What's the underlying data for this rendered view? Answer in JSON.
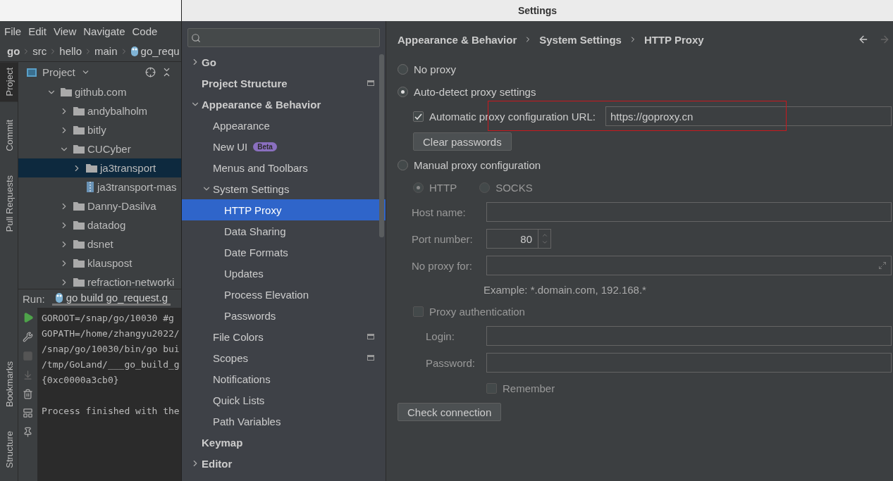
{
  "ide": {
    "menu": [
      "File",
      "Edit",
      "View",
      "Navigate",
      "Code"
    ],
    "breadcrumb": [
      {
        "label": "go",
        "kind": "root"
      },
      {
        "label": "src",
        "kind": "folder"
      },
      {
        "label": "hello",
        "kind": "folder"
      },
      {
        "label": "main",
        "kind": "folder"
      },
      {
        "label": "go_requ",
        "kind": "file"
      }
    ],
    "tool_tabs_top": [
      {
        "label": "Project",
        "selected": true
      },
      {
        "label": "Commit",
        "selected": false
      },
      {
        "label": "Pull Requests",
        "selected": false
      }
    ],
    "tool_tabs_bottom": [
      {
        "label": "Bookmarks",
        "selected": false
      },
      {
        "label": "Structure",
        "selected": false
      }
    ],
    "project_panel": {
      "title": "Project",
      "tree": [
        {
          "label": "github.com",
          "kind": "folder",
          "expanded": true,
          "selected": false,
          "children": [
            {
              "label": "andybalholm",
              "kind": "folder",
              "expanded": false,
              "selected": false
            },
            {
              "label": "bitly",
              "kind": "folder",
              "expanded": false,
              "selected": false
            },
            {
              "label": "CUCyber",
              "kind": "folder",
              "expanded": true,
              "selected": false,
              "children": [
                {
                  "label": "ja3transport",
                  "kind": "folder",
                  "expanded": false,
                  "selected": true
                },
                {
                  "label": "ja3transport-mas",
                  "kind": "archive",
                  "selected": false
                }
              ]
            },
            {
              "label": "Danny-Dasilva",
              "kind": "folder",
              "expanded": false,
              "selected": false
            },
            {
              "label": "datadog",
              "kind": "folder",
              "expanded": false,
              "selected": false
            },
            {
              "label": "dsnet",
              "kind": "folder",
              "expanded": false,
              "selected": false
            },
            {
              "label": "klauspost",
              "kind": "folder",
              "expanded": false,
              "selected": false
            },
            {
              "label": "refraction-networki",
              "kind": "folder",
              "expanded": false,
              "selected": false
            }
          ]
        }
      ]
    },
    "run": {
      "label": "Run:",
      "tab": "go build go_request.g",
      "console": [
        {
          "text": "GOROOT=/snap/go/10030 #g",
          "kind": "line"
        },
        {
          "text": "GOPATH=/home/zhangyu2022/",
          "kind": "line"
        },
        {
          "text": "/snap/go/10030/bin/go bui",
          "kind": "line"
        },
        {
          "text": "/tmp/GoLand/___go_build_g",
          "kind": "line"
        },
        {
          "text": "{0xc0000a3cb0}",
          "kind": "line"
        },
        {
          "text": "Process finished with the",
          "kind": "exit"
        }
      ]
    }
  },
  "settings": {
    "title": "Settings",
    "sidebar": [
      {
        "label": "Go",
        "expanded": false,
        "selected": false
      },
      {
        "label": "Project Structure",
        "project_level": true,
        "selected": false
      },
      {
        "label": "Appearance & Behavior",
        "expanded": true,
        "selected": false,
        "children": [
          {
            "label": "Appearance",
            "selected": false
          },
          {
            "label": "New UI",
            "badge": "Beta",
            "selected": false
          },
          {
            "label": "Menus and Toolbars",
            "selected": false
          },
          {
            "label": "System Settings",
            "expanded": true,
            "selected": false,
            "children": [
              {
                "label": "HTTP Proxy",
                "selected": true
              },
              {
                "label": "Data Sharing",
                "selected": false
              },
              {
                "label": "Date Formats",
                "selected": false
              },
              {
                "label": "Updates",
                "selected": false
              },
              {
                "label": "Process Elevation",
                "selected": false
              },
              {
                "label": "Passwords",
                "selected": false
              }
            ]
          },
          {
            "label": "File Colors",
            "project_level": true,
            "selected": false
          },
          {
            "label": "Scopes",
            "project_level": true,
            "selected": false
          },
          {
            "label": "Notifications",
            "selected": false
          },
          {
            "label": "Quick Lists",
            "selected": false
          },
          {
            "label": "Path Variables",
            "selected": false
          }
        ]
      },
      {
        "label": "Keymap",
        "selected": false
      },
      {
        "label": "Editor",
        "expanded": false,
        "selected": false
      }
    ],
    "breadcrumb": [
      "Appearance & Behavior",
      "System Settings",
      "HTTP Proxy"
    ],
    "no_proxy": {
      "label": "No proxy",
      "selected": false
    },
    "auto_detect": {
      "label": "Auto-detect proxy settings",
      "selected": true,
      "pac": {
        "label": "Automatic proxy configuration URL:",
        "checked": true,
        "value": "https://goproxy.cn"
      },
      "clear_button": "Clear passwords"
    },
    "manual": {
      "label": "Manual proxy configuration",
      "selected": false,
      "disabled": true,
      "protocols": [
        {
          "label": "HTTP",
          "selected": true
        },
        {
          "label": "SOCKS",
          "selected": false
        }
      ],
      "host_label": "Host name:",
      "port_label": "Port number:",
      "port": "80",
      "no_proxy_label": "No proxy for:",
      "example": "Example: *.domain.com, 192.168.*",
      "auth": {
        "label": "Proxy authentication",
        "checked": false
      },
      "login_label": "Login:",
      "password_label": "Password:",
      "remember": {
        "label": "Remember",
        "checked": false
      }
    },
    "check_button": "Check connection"
  }
}
